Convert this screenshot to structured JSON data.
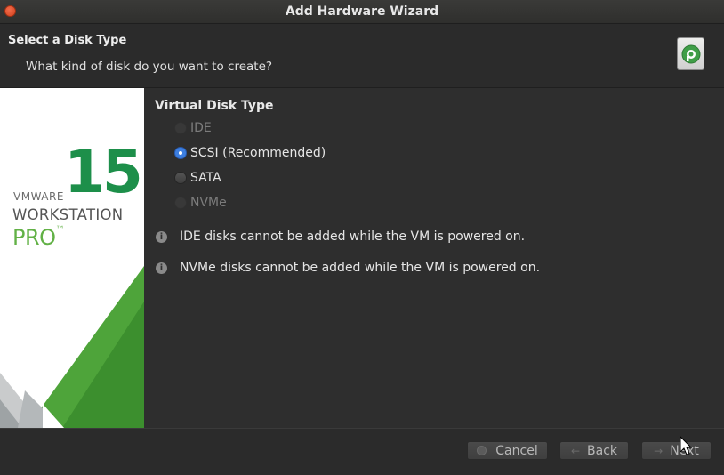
{
  "window": {
    "title": "Add Hardware Wizard"
  },
  "header": {
    "title": "Select a Disk Type",
    "subtitle": "What kind of disk do you want to create?"
  },
  "branding": {
    "version": "15",
    "vendor": "VMWARE",
    "product": "WORKSTATION",
    "edition": "PRO",
    "trademark": "™"
  },
  "disk_type": {
    "title": "Virtual Disk Type",
    "options": [
      {
        "label": "IDE",
        "selected": false,
        "enabled": false
      },
      {
        "label": "SCSI (Recommended)",
        "selected": true,
        "enabled": true
      },
      {
        "label": "SATA",
        "selected": false,
        "enabled": true
      },
      {
        "label": "NVMe",
        "selected": false,
        "enabled": false
      }
    ]
  },
  "info": [
    {
      "icon": "info-icon",
      "text": "IDE disks cannot be added while the VM is powered on."
    },
    {
      "icon": "info-icon",
      "text": "NVMe disks cannot be added while the VM is powered on."
    }
  ],
  "footer": {
    "cancel_label": "Cancel",
    "back_label": "Back",
    "next_label": "Next"
  },
  "colors": {
    "accent_green": "#1d8f4a",
    "pro_green": "#62b146",
    "radio_selected": "#3d7fe0"
  }
}
